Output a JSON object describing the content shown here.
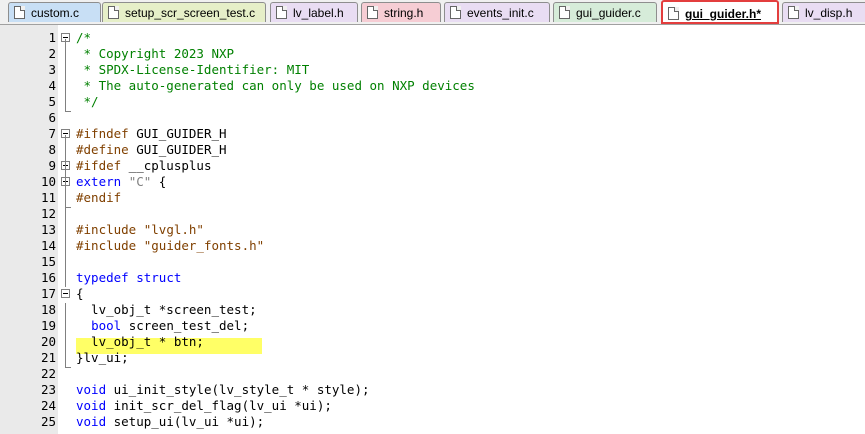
{
  "tabs": [
    {
      "name": "tab-custom-c",
      "label": "custom.c",
      "color": "#c8dff5"
    },
    {
      "name": "tab-setup-scr-screen-test-c",
      "label": "setup_scr_screen_test.c",
      "color": "#e6efc8"
    },
    {
      "name": "tab-lv-label-h",
      "label": "lv_label.h",
      "color": "#e9ddf3"
    },
    {
      "name": "tab-string-h",
      "label": "string.h",
      "color": "#f6cdd4"
    },
    {
      "name": "tab-events-init-c",
      "label": "events_init.c",
      "color": "#e9ddf3"
    },
    {
      "name": "tab-gui-guider-c",
      "label": "gui_guider.c",
      "color": "#d6ecd9"
    },
    {
      "name": "tab-gui-guider-h-active",
      "label": "gui_guider.h*",
      "color": "#ffffff"
    },
    {
      "name": "tab-lv-disp-h",
      "label": "lv_disp.h",
      "color": "#e9ddf3"
    }
  ],
  "code_lines": [
    {
      "n": "1",
      "segs": [
        {
          "c": "cm",
          "t": "/*"
        }
      ]
    },
    {
      "n": "2",
      "segs": [
        {
          "c": "cm",
          "t": " * Copyright 2023 NXP"
        }
      ]
    },
    {
      "n": "3",
      "segs": [
        {
          "c": "cm",
          "t": " * SPDX-License-Identifier: MIT"
        }
      ]
    },
    {
      "n": "4",
      "segs": [
        {
          "c": "cm",
          "t": " * The auto-generated can only be used on NXP devices"
        }
      ]
    },
    {
      "n": "5",
      "segs": [
        {
          "c": "cm",
          "t": " */"
        }
      ]
    },
    {
      "n": "6",
      "segs": []
    },
    {
      "n": "7",
      "segs": [
        {
          "c": "pp",
          "t": "#ifndef"
        },
        {
          "c": "",
          "t": " GUI_GUIDER_H"
        }
      ]
    },
    {
      "n": "8",
      "segs": [
        {
          "c": "pp",
          "t": "#define"
        },
        {
          "c": "",
          "t": " GUI_GUIDER_H"
        }
      ]
    },
    {
      "n": "9",
      "segs": [
        {
          "c": "pp",
          "t": "#ifdef"
        },
        {
          "c": "",
          "t": " __cplusplus"
        }
      ]
    },
    {
      "n": "10",
      "segs": [
        {
          "c": "kw",
          "t": "extern"
        },
        {
          "c": "",
          "t": " "
        },
        {
          "c": "st",
          "t": "\"C\""
        },
        {
          "c": "",
          "t": " {"
        }
      ]
    },
    {
      "n": "11",
      "segs": [
        {
          "c": "pp",
          "t": "#endif"
        }
      ]
    },
    {
      "n": "12",
      "segs": []
    },
    {
      "n": "13",
      "segs": [
        {
          "c": "pp",
          "t": "#include"
        },
        {
          "c": "",
          "t": " "
        },
        {
          "c": "pp",
          "t": "\"lvgl.h\""
        }
      ]
    },
    {
      "n": "14",
      "segs": [
        {
          "c": "pp",
          "t": "#include"
        },
        {
          "c": "",
          "t": " "
        },
        {
          "c": "pp",
          "t": "\"guider_fonts.h\""
        }
      ]
    },
    {
      "n": "15",
      "segs": []
    },
    {
      "n": "16",
      "segs": [
        {
          "c": "kw",
          "t": "typedef"
        },
        {
          "c": "",
          "t": " "
        },
        {
          "c": "kw",
          "t": "struct"
        }
      ]
    },
    {
      "n": "17",
      "segs": [
        {
          "c": "",
          "t": "{"
        }
      ]
    },
    {
      "n": "18",
      "segs": [
        {
          "c": "",
          "t": "  lv_obj_t *screen_test;"
        }
      ]
    },
    {
      "n": "19",
      "segs": [
        {
          "c": "",
          "t": "  "
        },
        {
          "c": "kw",
          "t": "bool"
        },
        {
          "c": "",
          "t": " screen_test_del;"
        }
      ]
    },
    {
      "n": "20",
      "segs": [
        {
          "c": "",
          "t": "  lv_obj_t * btn;"
        }
      ]
    },
    {
      "n": "21",
      "segs": [
        {
          "c": "",
          "t": "}lv_ui;"
        }
      ]
    },
    {
      "n": "22",
      "segs": []
    },
    {
      "n": "23",
      "segs": [
        {
          "c": "kw",
          "t": "void"
        },
        {
          "c": "",
          "t": " ui_init_style(lv_style_t * style);"
        }
      ]
    },
    {
      "n": "24",
      "segs": [
        {
          "c": "kw",
          "t": "void"
        },
        {
          "c": "",
          "t": " init_scr_del_flag(lv_ui *ui);"
        }
      ]
    },
    {
      "n": "25",
      "segs": [
        {
          "c": "kw",
          "t": "void"
        },
        {
          "c": "",
          "t": " setup_ui(lv_ui *ui);"
        }
      ]
    }
  ],
  "highlighted_line": "20",
  "colors": {
    "comment": "#008000",
    "preprocessor": "#804000",
    "keyword": "#0000ff",
    "string": "#808080",
    "highlight": "#ffff66",
    "active_tab_border": "#e33e3e"
  }
}
